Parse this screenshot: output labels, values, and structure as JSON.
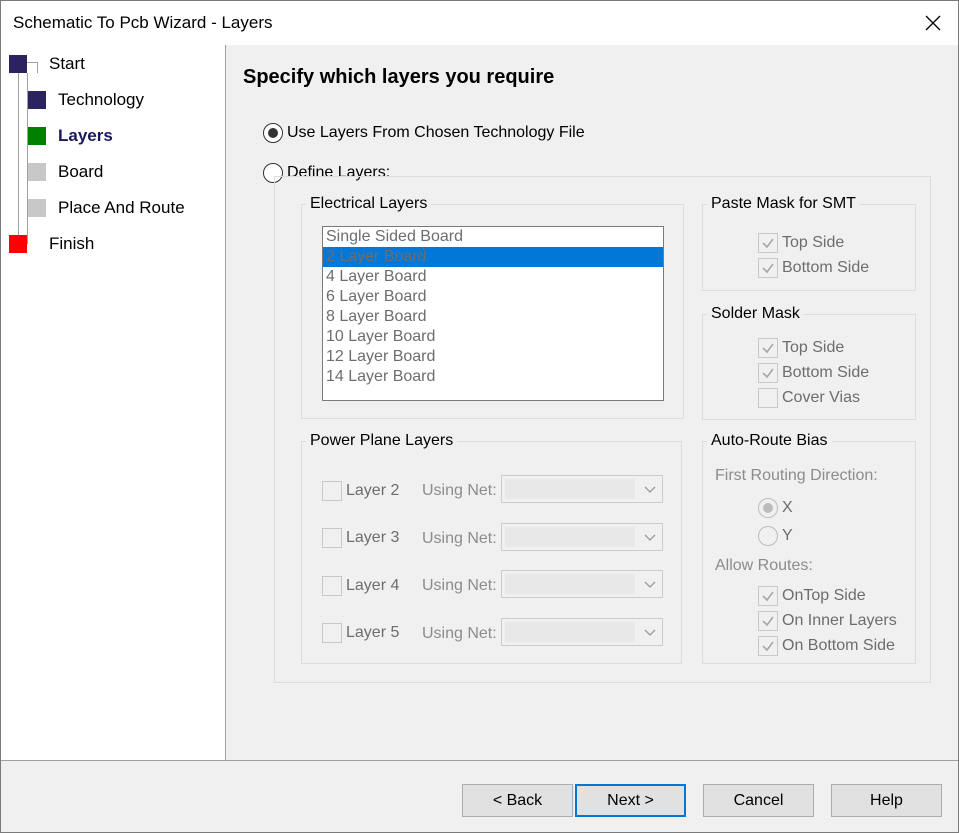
{
  "window": {
    "title": "Schematic To Pcb Wizard - Layers"
  },
  "steps": [
    {
      "label": "Start",
      "color": "#2b2360"
    },
    {
      "label": "Technology",
      "color": "#2b2360"
    },
    {
      "label": "Layers",
      "color": "#008000"
    },
    {
      "label": "Board",
      "color": "#c8c8c8"
    },
    {
      "label": "Place And Route",
      "color": "#c8c8c8"
    },
    {
      "label": "Finish",
      "color": "#ff0000"
    }
  ],
  "main": {
    "heading": "Specify which layers you require",
    "radio_use_tech": "Use Layers From Chosen Technology File",
    "radio_define": "Define Layers:",
    "electrical": {
      "title": "Electrical Layers",
      "items": [
        "Single Sided Board",
        "2 Layer Board",
        "4 Layer Board",
        "6 Layer Board",
        "8 Layer Board",
        "10 Layer Board",
        "12 Layer Board",
        "14 Layer Board"
      ],
      "selected": "2 Layer Board"
    },
    "paste_mask": {
      "title": "Paste Mask for SMT",
      "top": "Top Side",
      "bottom": "Bottom Side"
    },
    "solder_mask": {
      "title": "Solder Mask",
      "top": "Top Side",
      "bottom": "Bottom Side",
      "vias": "Cover Vias"
    },
    "power_plane": {
      "title": "Power Plane Layers",
      "using_net": "Using Net:",
      "layers": [
        "Layer 2",
        "Layer 3",
        "Layer 4",
        "Layer 5"
      ]
    },
    "autoroute": {
      "title": "Auto-Route Bias",
      "first_dir": "First Routing Direction:",
      "x": "X",
      "y": "Y",
      "allow": "Allow Routes:",
      "ontop": "OnTop Side",
      "inner": "On Inner Layers",
      "bottom": "On Bottom Side"
    }
  },
  "buttons": {
    "back": "< Back",
    "next": "Next >",
    "cancel": "Cancel",
    "help": "Help"
  }
}
